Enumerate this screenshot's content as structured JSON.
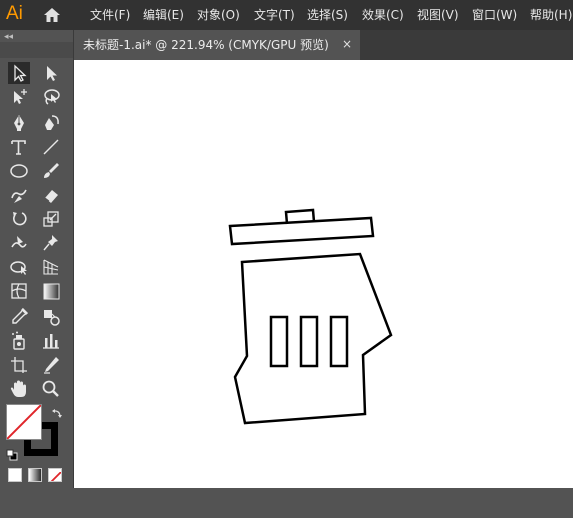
{
  "app": {
    "logo": "Ai",
    "brand_color": "#FF9A00"
  },
  "menu": [
    "文件(F)",
    "编辑(E)",
    "对象(O)",
    "文字(T)",
    "选择(S)",
    "效果(C)",
    "视图(V)",
    "窗口(W)",
    "帮助(H)"
  ],
  "toolbar": {
    "collapse": "◂◂"
  },
  "document": {
    "tab_title": "未标题-1.ai* @ 221.94% (CMYK/GPU 预览)",
    "close": "×",
    "zoom": "221.94%",
    "color_mode": "CMYK/GPU 预览"
  },
  "colors": {
    "fill": "#FFFFFF",
    "stroke": "#000000",
    "none_slash": "#E0262B",
    "canvas": "#FFFFFF",
    "ui_dark": "#323232",
    "ui_mid": "#535353"
  },
  "tools": [
    "selection-tool",
    "direct-selection-tool",
    "magic-wand-tool",
    "lasso-tool",
    "pen-tool",
    "curvature-tool",
    "type-tool",
    "line-segment-tool",
    "ellipse-tool",
    "paintbrush-tool",
    "shaper-tool",
    "eraser-tool",
    "rotate-tool",
    "scale-tool",
    "puppet-warp-tool",
    "pin-tool",
    "free-transform-tool",
    "perspective-grid-tool",
    "mesh-tool",
    "gradient-tool",
    "eyedropper-tool",
    "blend-tool",
    "symbol-sprayer-tool",
    "column-graph-tool",
    "artboard-tool",
    "slice-tool",
    "hand-tool",
    "zoom-tool"
  ]
}
